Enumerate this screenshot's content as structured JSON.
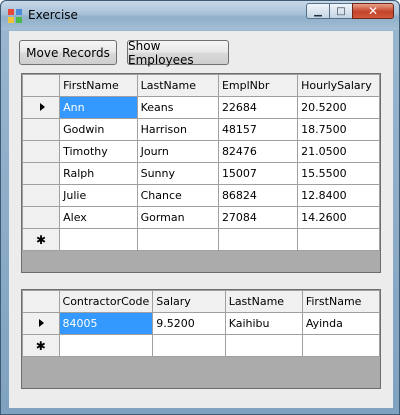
{
  "window": {
    "title": "Exercise",
    "minimize_glyph": "▁",
    "maximize_glyph": "□",
    "close_glyph": "✕"
  },
  "toolbar": {
    "move_records_label": "Move Records",
    "show_employees_label": "Show Employees"
  },
  "employees_grid": {
    "columns": [
      "FirstName",
      "LastName",
      "EmplNbr",
      "HourlySalary"
    ],
    "rows": [
      [
        "Ann",
        "Keans",
        "22684",
        "20.5200"
      ],
      [
        "Godwin",
        "Harrison",
        "48157",
        "18.7500"
      ],
      [
        "Timothy",
        "Journ",
        "82476",
        "21.0500"
      ],
      [
        "Ralph",
        "Sunny",
        "15007",
        "15.5500"
      ],
      [
        "Julie",
        "Chance",
        "86824",
        "12.8400"
      ],
      [
        "Alex",
        "Gorman",
        "27084",
        "14.2600"
      ]
    ],
    "new_row_glyph": "✱"
  },
  "contractors_grid": {
    "columns": [
      "ContractorCode",
      "Salary",
      "LastName",
      "FirstName"
    ],
    "rows": [
      [
        "84005",
        "9.5200",
        "Kaihibu",
        "Ayinda"
      ]
    ],
    "new_row_glyph": "✱"
  },
  "colors": {
    "selection": "#3399ff",
    "grid_background": "#ababab",
    "close_button": "#c5432a"
  }
}
